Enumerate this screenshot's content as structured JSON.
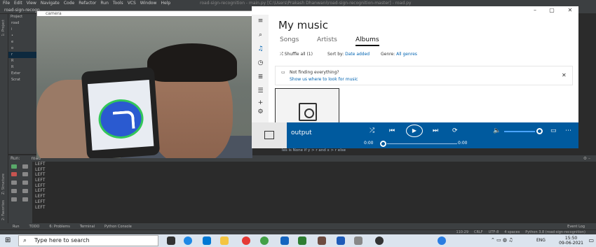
{
  "ide": {
    "menus": [
      "File",
      "Edit",
      "View",
      "Navigate",
      "Code",
      "Refactor",
      "Run",
      "Tools",
      "VCS",
      "Window",
      "Help"
    ],
    "window_title": "road-sign-recognition - main.py [C:\\Users\\Prakash Dhanwani\\road-sign-recognition-master] - road.py",
    "breadcrumb": "road-sign-recogn",
    "project_label": "Project",
    "project_tree": [
      "road",
      "i",
      "•",
      "e",
      "o",
      "r",
      "R",
      "R",
      "Exter",
      "Scrat"
    ],
    "code_line": "les is None    if y > r and x > r    else",
    "run_label": "Run:",
    "run_config": "road",
    "console_lines": [
      "LEFT",
      "LEFT",
      "LEFT",
      "LEFT",
      "LEFT",
      "LEFT",
      "LEFT",
      "LEFT",
      "LEFT"
    ],
    "bottom_tabs": [
      "Run",
      "TODO",
      "6: Problems",
      "Terminal",
      "Python Console"
    ],
    "event_log": "Event Log",
    "status": [
      "110:29",
      "CRLF",
      "UTF-8",
      "4 spaces",
      "Python 3.8 (road-sign-recognition)"
    ],
    "side_labels": [
      "1: Project",
      "Z: Structure",
      "2: Favorites"
    ]
  },
  "camera": {
    "title": "camera"
  },
  "groove": {
    "title": "My music",
    "tabs": [
      "Songs",
      "Artists",
      "Albums"
    ],
    "active_tab": "Albums",
    "shuffle": "Shuffle all (1)",
    "sort_label": "Sort by:",
    "sort_value": "Date added",
    "genre_label": "Genre:",
    "genre_value": "All genres",
    "not_finding": "Not finding everything?",
    "show_where": "Show us where to look for music",
    "player_title": "output",
    "time_start": "0:00",
    "time_end": "0:00"
  },
  "taskbar": {
    "search_placeholder": "Type here to search",
    "lang": "ENG",
    "time": "15:50",
    "date": "09-06-2021"
  },
  "colors": {
    "ide_bg": "#2b2b2b",
    "ide_panel": "#3c3f41",
    "groove_accent": "#005a9e",
    "link": "#0063b1"
  }
}
